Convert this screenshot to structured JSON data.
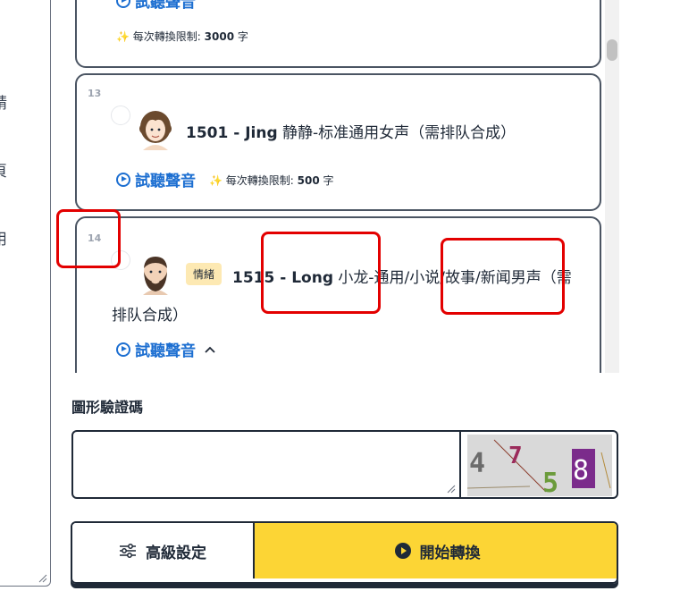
{
  "left_pane": {
    "chars": [
      "請",
      "頁",
      "用"
    ]
  },
  "voice_cards": [
    {
      "number": "",
      "listen_label": "試聽聲音",
      "limit_label": "每次轉換限制:",
      "limit_value": "3000",
      "limit_unit": "字"
    },
    {
      "number": "13",
      "title_bold": "1501 - Jing",
      "title_rest": "静静-标准通用女声（需排队合成）",
      "listen_label": "試聽聲音",
      "limit_label": "每次轉換限制:",
      "limit_value": "500",
      "limit_unit": "字"
    },
    {
      "number": "14",
      "badge": "情緒",
      "title_bold": "1515 - Long",
      "title_rest_line1": "小龙-通用/小说/故事/新闻男声（需",
      "title_rest_line2": "排队合成）",
      "listen_label": "試聽聲音",
      "expand_icon": "chevron-up-icon"
    }
  ],
  "captcha": {
    "label": "圖形驗證碼",
    "value": "",
    "image_chars": [
      "4",
      "7",
      "5",
      "8"
    ]
  },
  "buttons": {
    "advanced_label": "高級設定",
    "start_label": "開始轉換"
  },
  "colors": {
    "accent_blue": "#1d6fd1",
    "start_yellow": "#fcd535",
    "badge_bg": "#fde9b3",
    "annotation_red": "#e30000"
  }
}
